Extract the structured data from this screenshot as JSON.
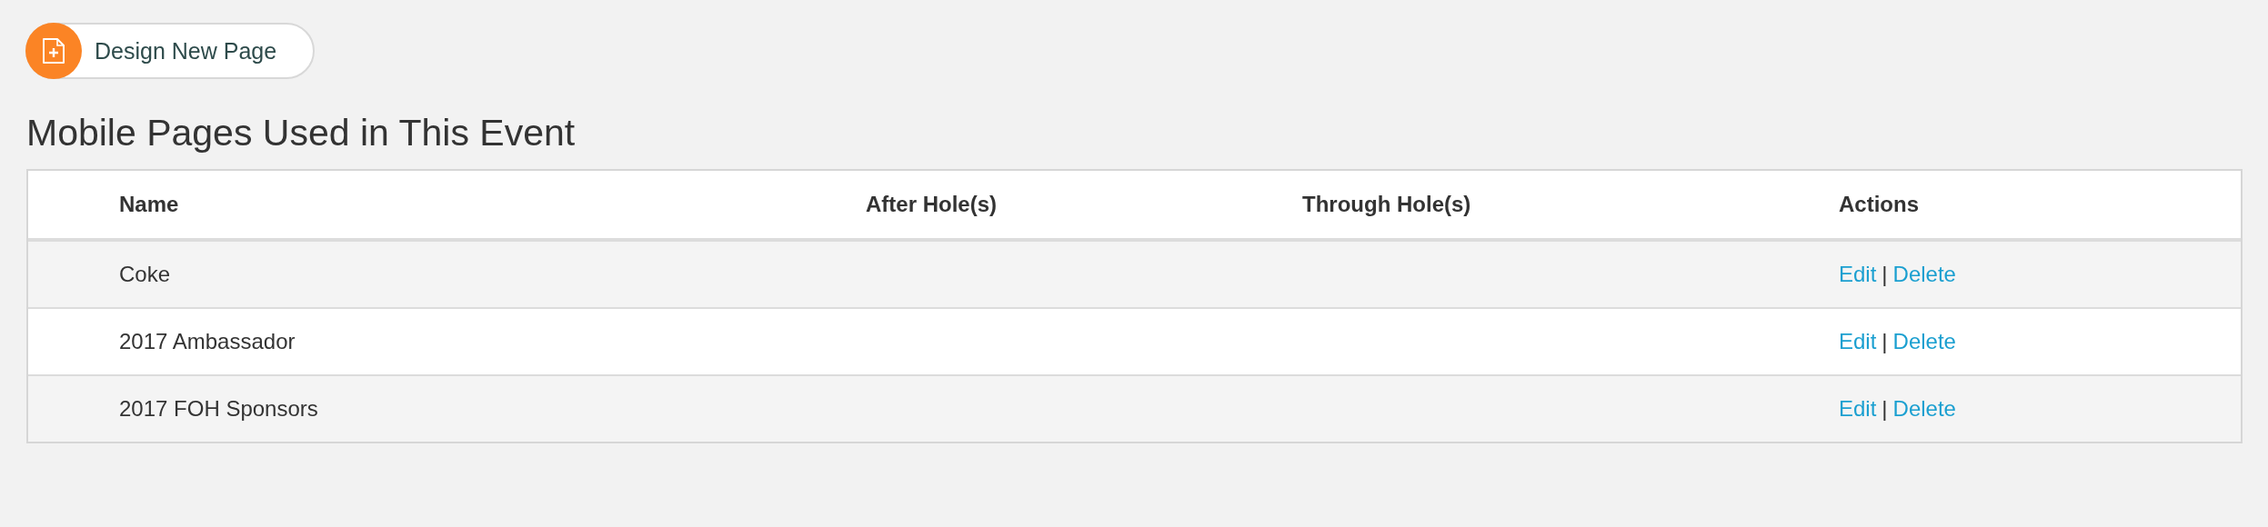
{
  "design_button": {
    "label": "Design New Page"
  },
  "heading": "Mobile Pages Used in This Event",
  "table": {
    "columns": [
      "Name",
      "After Hole(s)",
      "Through Hole(s)",
      "Actions"
    ],
    "rows": [
      {
        "name": "Coke",
        "actions": [
          "Edit",
          "|",
          "Delete"
        ]
      },
      {
        "name": "2017 Ambassador",
        "actions": [
          "Edit",
          "|",
          "Delete"
        ]
      },
      {
        "name": "2017 FOH Sponsors",
        "actions": [
          "Edit",
          "|",
          "Delete"
        ]
      }
    ]
  }
}
